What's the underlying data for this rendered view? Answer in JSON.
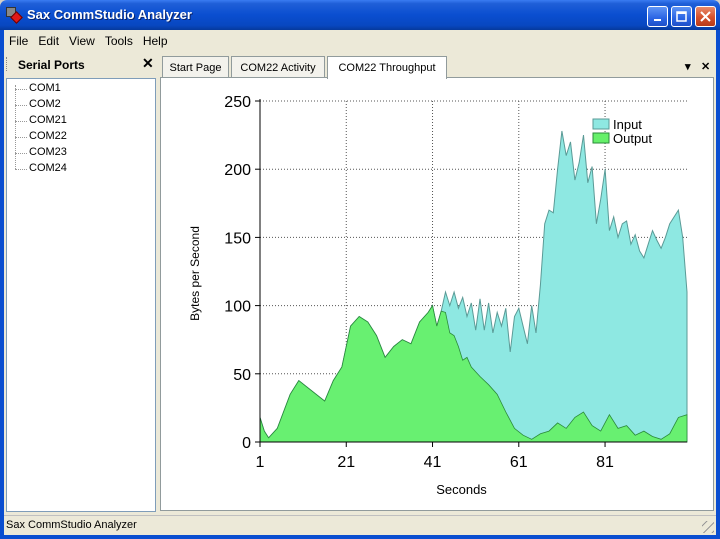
{
  "window": {
    "title": "Sax CommStudio Analyzer",
    "minimize": "_",
    "maximize": "□",
    "close": "✕"
  },
  "menu": [
    {
      "label": "File"
    },
    {
      "label": "Edit"
    },
    {
      "label": "View"
    },
    {
      "label": "Tools"
    },
    {
      "label": "Help"
    }
  ],
  "sidebar": {
    "title": "Serial Ports",
    "close": "✕",
    "items": [
      {
        "label": "COM1"
      },
      {
        "label": "COM2"
      },
      {
        "label": "COM21"
      },
      {
        "label": "COM22"
      },
      {
        "label": "COM23"
      },
      {
        "label": "COM24"
      }
    ]
  },
  "tabs": [
    {
      "label": "Start Page",
      "active": false
    },
    {
      "label": "COM22 Activity",
      "active": false
    },
    {
      "label": "COM22 Throughput",
      "active": true
    }
  ],
  "tab_controls": {
    "dropdown": "▾",
    "close": "✕"
  },
  "statusbar": {
    "text": "Sax CommStudio Analyzer"
  },
  "colors": {
    "input": "#8ee8e2",
    "input_stroke": "#5a9a96",
    "output": "#33dd55",
    "output_light": "#66f06a",
    "output_stroke": "#2a8a3a"
  },
  "chart_data": {
    "type": "area",
    "title": "",
    "xlabel": "Seconds",
    "ylabel": "Bytes per Second",
    "xlim": [
      1,
      100
    ],
    "ylim": [
      0,
      250
    ],
    "x_ticks": [
      1,
      21,
      41,
      61,
      81
    ],
    "y_ticks": [
      0,
      50,
      100,
      150,
      200,
      250
    ],
    "grid": true,
    "legend_position": "top-right",
    "series": [
      {
        "name": "Input",
        "x": [
          1,
          2,
          3,
          5,
          8,
          10,
          12,
          14,
          16,
          18,
          20,
          22,
          24,
          26,
          28,
          30,
          32,
          34,
          36,
          38,
          40,
          41,
          42,
          43,
          44,
          45,
          46,
          47,
          48,
          49,
          50,
          51,
          52,
          53,
          54,
          55,
          56,
          57,
          58,
          59,
          60,
          61,
          62,
          63,
          64,
          65,
          66,
          67,
          68,
          69,
          70,
          71,
          72,
          73,
          74,
          75,
          76,
          77,
          78,
          79,
          80,
          81,
          82,
          83,
          84,
          85,
          86,
          87,
          88,
          89,
          90,
          91,
          92,
          93,
          94,
          95,
          96,
          97,
          98,
          99,
          100
        ],
        "values": [
          18,
          8,
          3,
          10,
          35,
          45,
          40,
          35,
          30,
          45,
          55,
          85,
          92,
          88,
          78,
          62,
          70,
          75,
          72,
          88,
          95,
          100,
          85,
          96,
          110,
          100,
          110,
          98,
          106,
          92,
          102,
          82,
          105,
          82,
          102,
          80,
          95,
          85,
          98,
          66,
          92,
          98,
          85,
          72,
          100,
          80,
          115,
          160,
          170,
          168,
          200,
          228,
          210,
          220,
          192,
          205,
          225,
          190,
          202,
          160,
          178,
          200,
          155,
          165,
          150,
          160,
          162,
          145,
          152,
          140,
          135,
          145,
          155,
          148,
          142,
          150,
          160,
          165,
          170,
          150,
          110
        ]
      },
      {
        "name": "Output",
        "x": [
          1,
          2,
          3,
          5,
          8,
          10,
          12,
          14,
          16,
          18,
          20,
          22,
          24,
          26,
          28,
          30,
          32,
          34,
          36,
          38,
          40,
          41,
          42,
          43,
          44,
          45,
          46,
          47,
          48,
          49,
          50,
          52,
          54,
          56,
          58,
          60,
          62,
          64,
          66,
          68,
          70,
          72,
          74,
          76,
          78,
          80,
          82,
          84,
          86,
          88,
          90,
          92,
          94,
          96,
          98,
          100
        ],
        "values": [
          18,
          8,
          3,
          10,
          35,
          45,
          40,
          35,
          30,
          45,
          55,
          85,
          92,
          88,
          78,
          62,
          70,
          75,
          72,
          88,
          95,
          100,
          85,
          96,
          95,
          80,
          78,
          70,
          60,
          62,
          55,
          48,
          42,
          35,
          22,
          10,
          5,
          2,
          6,
          8,
          14,
          10,
          18,
          22,
          12,
          8,
          20,
          10,
          12,
          5,
          8,
          4,
          2,
          6,
          18,
          20
        ]
      }
    ]
  }
}
